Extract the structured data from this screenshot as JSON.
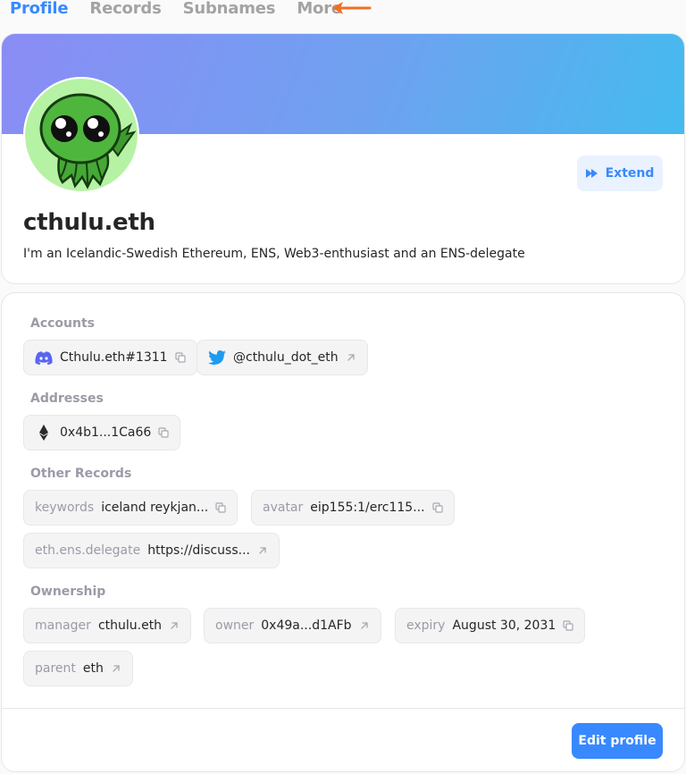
{
  "tabs": [
    {
      "label": "Profile",
      "active": true
    },
    {
      "label": "Records",
      "active": false
    },
    {
      "label": "Subnames",
      "active": false
    },
    {
      "label": "More",
      "active": false
    }
  ],
  "profile": {
    "name": "cthulu.eth",
    "bio": "I'm an Icelandic-Swedish Ethereum, ENS, Web3-enthusiast and an ENS-delegate",
    "extend_label": "Extend",
    "avatar_icon": "cthulhu-avatar"
  },
  "records": {
    "accounts_label": "Accounts",
    "accounts": [
      {
        "icon": "discord-icon",
        "value": "Cthulu.eth#1311",
        "action": "copy"
      },
      {
        "icon": "twitter-icon",
        "value": "@cthulu_dot_eth",
        "action": "link"
      }
    ],
    "addresses_label": "Addresses",
    "addresses": [
      {
        "icon": "ethereum-icon",
        "value": "0x4b1...1Ca66",
        "action": "copy"
      }
    ],
    "other_label": "Other Records",
    "other": [
      {
        "key": "keywords",
        "value": "iceland reykjan...",
        "action": "copy"
      },
      {
        "key": "avatar",
        "value": "eip155:1/erc115...",
        "action": "copy"
      },
      {
        "key": "eth.ens.delegate",
        "value": "https://discuss...",
        "action": "link"
      }
    ],
    "ownership_label": "Ownership",
    "ownership": [
      {
        "key": "manager",
        "value": "cthulu.eth",
        "action": "link"
      },
      {
        "key": "owner",
        "value": "0x49a...d1AFb",
        "action": "link"
      },
      {
        "key": "expiry",
        "value": "August 30, 2031",
        "action": "copy"
      },
      {
        "key": "parent",
        "value": "eth",
        "action": "link"
      }
    ],
    "edit_label": "Edit profile"
  },
  "colors": {
    "accent": "#3889ff",
    "arrow": "#f26f21",
    "banner_start": "#8b8cf5",
    "banner_end": "#44bbee"
  }
}
